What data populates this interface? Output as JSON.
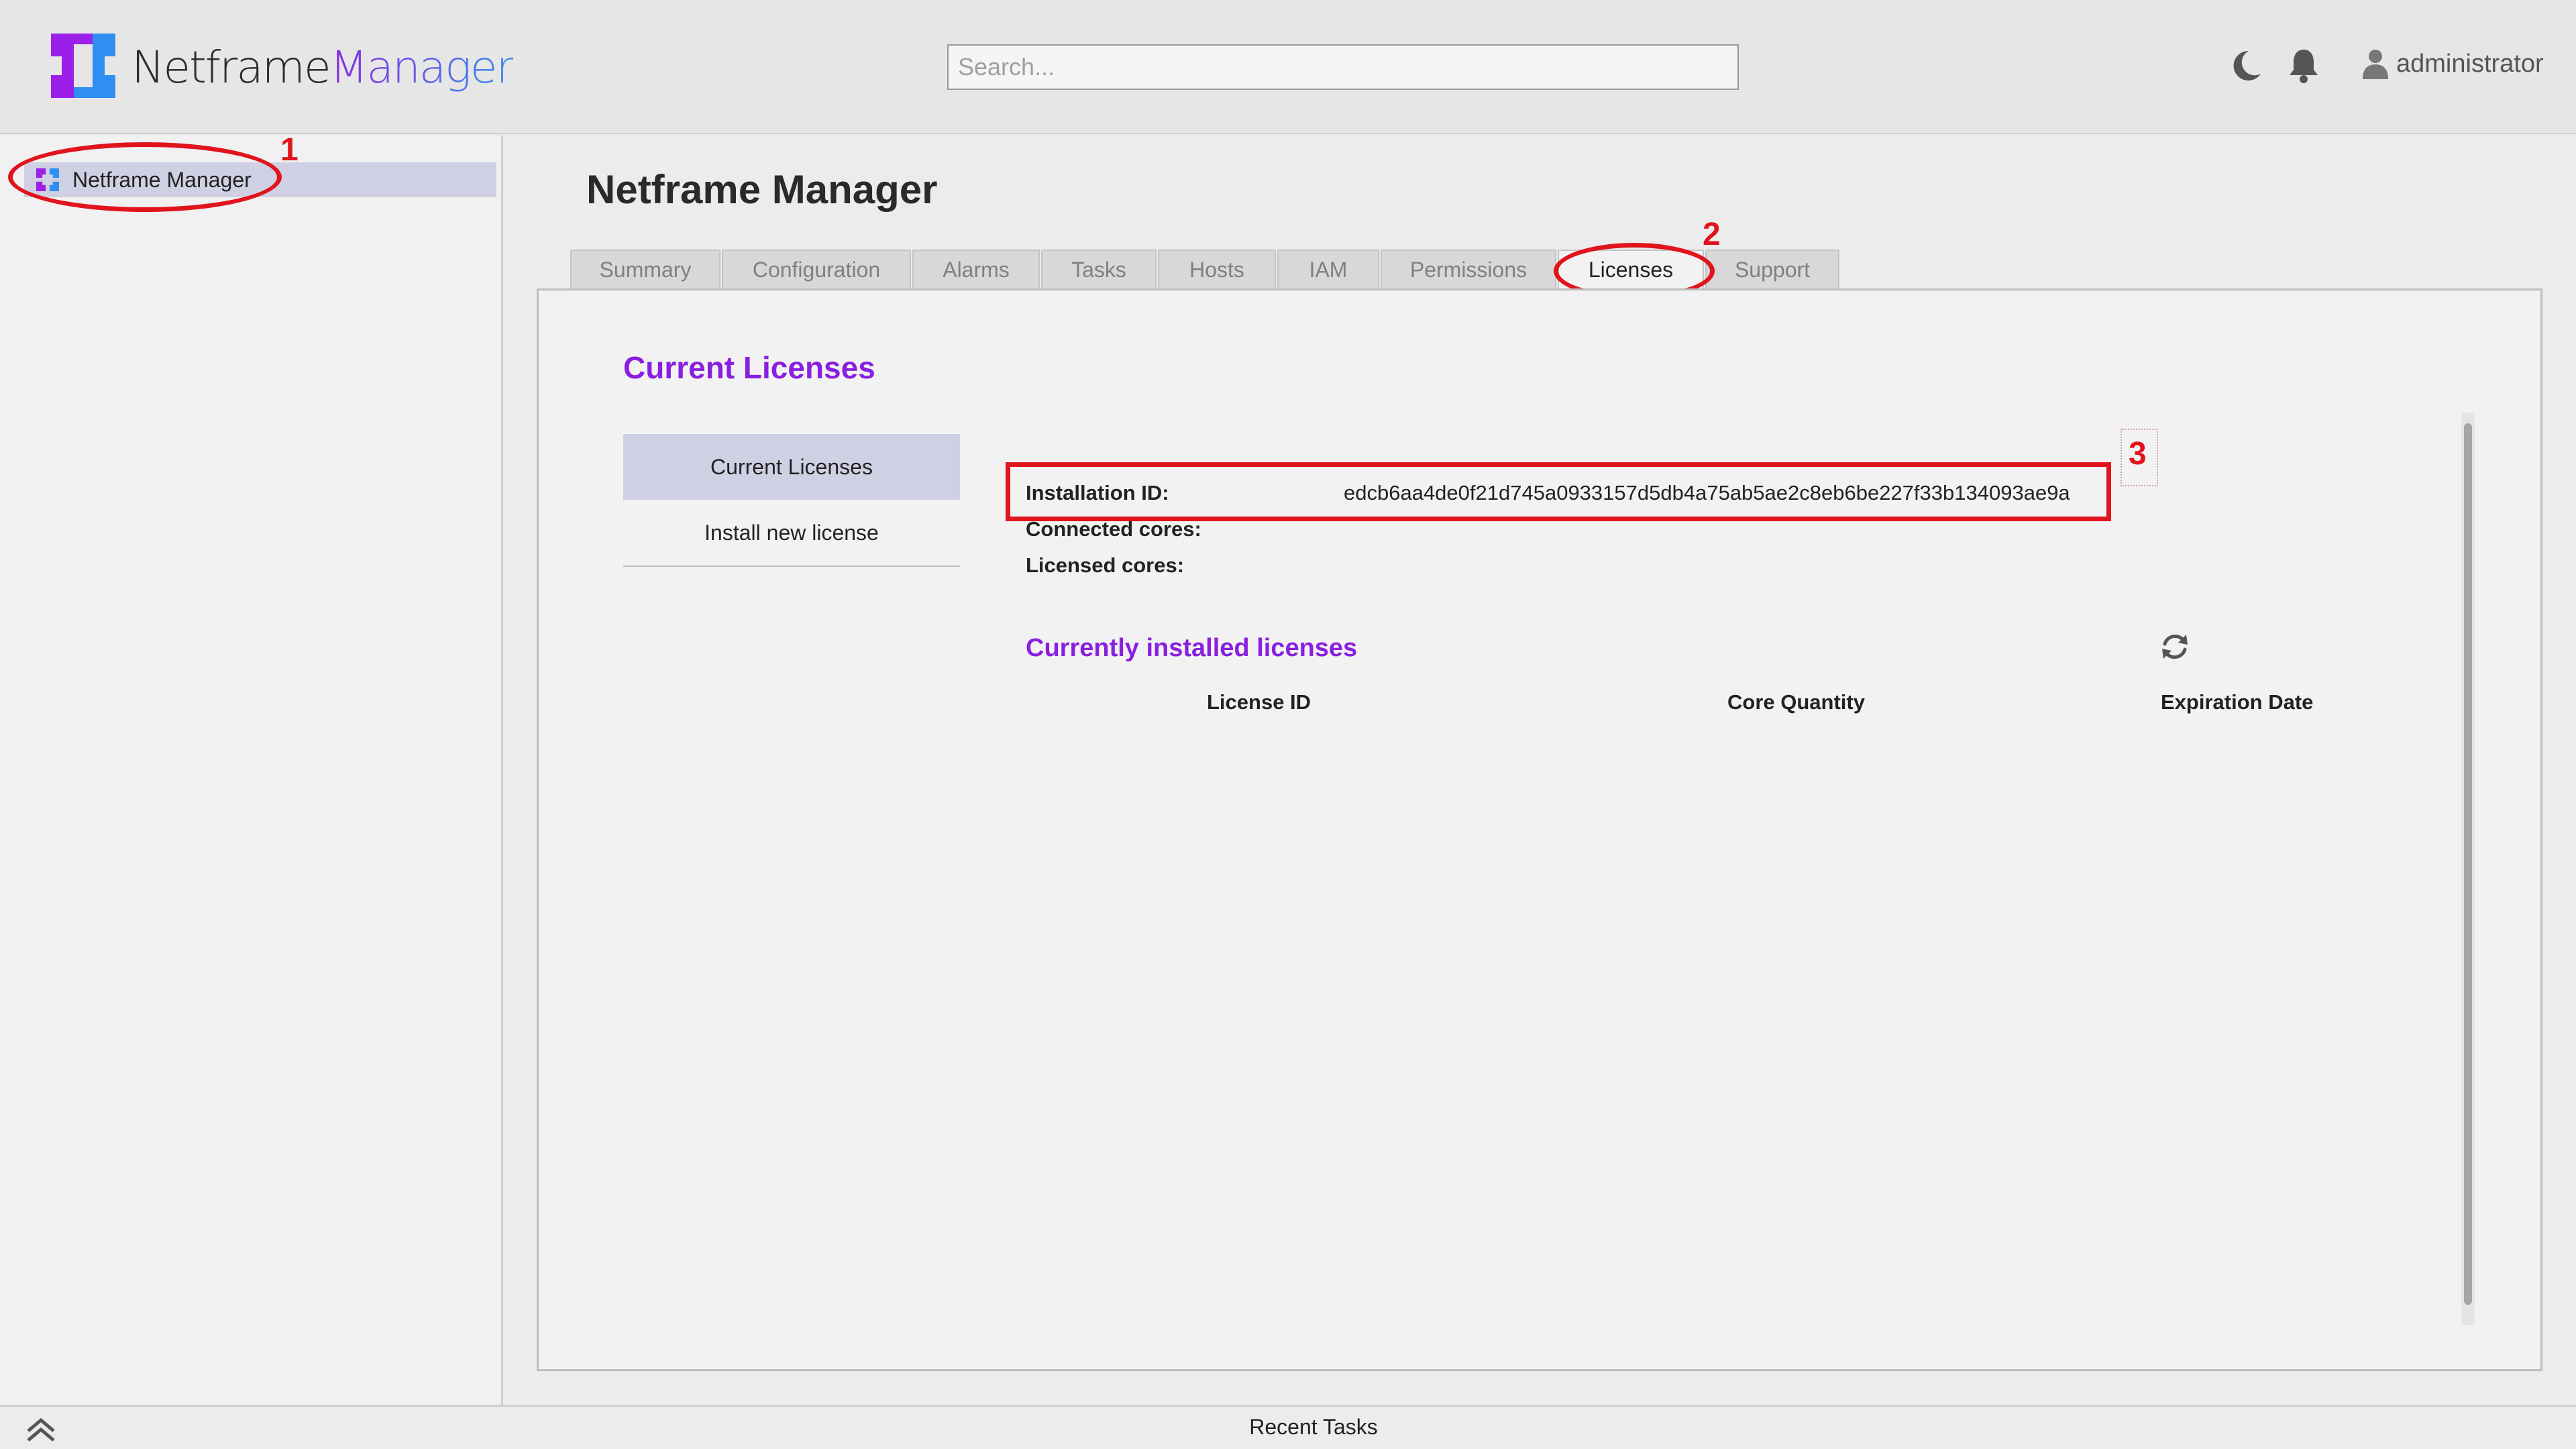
{
  "app": {
    "logo_part1": "Netframe",
    "logo_part2": "Manager",
    "search_placeholder": "Search...",
    "username": "administrator",
    "icons": [
      "logo-icon",
      "moon-icon",
      "bell-icon",
      "user-icon"
    ]
  },
  "sidebar": {
    "items": [
      {
        "label": "Netframe Manager",
        "icon": "netframe-logo-icon",
        "selected": true
      }
    ]
  },
  "main": {
    "title": "Netframe Manager",
    "tabs": [
      {
        "label": "Summary"
      },
      {
        "label": "Configuration"
      },
      {
        "label": "Alarms"
      },
      {
        "label": "Tasks"
      },
      {
        "label": "Hosts"
      },
      {
        "label": "IAM"
      },
      {
        "label": "Permissions"
      },
      {
        "label": "Licenses",
        "active": true
      },
      {
        "label": "Support"
      }
    ]
  },
  "licenses": {
    "section_title": "Current Licenses",
    "subnav": [
      {
        "label": "Current Licenses",
        "active": true
      },
      {
        "label": "Install new license"
      }
    ],
    "installation_id_label": "Installation ID:",
    "installation_id_value": "edcb6aa4de0f21d745a0933157d5db4a75ab5ae2c8eb6be227f33b134093ae9a",
    "connected_cores_label": "Connected cores:",
    "licensed_cores_label": "Licensed cores:",
    "installed_title": "Currently installed licenses",
    "columns": [
      "License ID",
      "Core Quantity",
      "Expiration Date"
    ]
  },
  "annotations": {
    "n1": "1",
    "n2": "2",
    "n3": "3"
  },
  "footer": {
    "recent_tasks": "Recent Tasks"
  },
  "colors": {
    "accent": "#8a1fe0",
    "annotation": "#e0141d",
    "selected": "#d0d0e4"
  }
}
